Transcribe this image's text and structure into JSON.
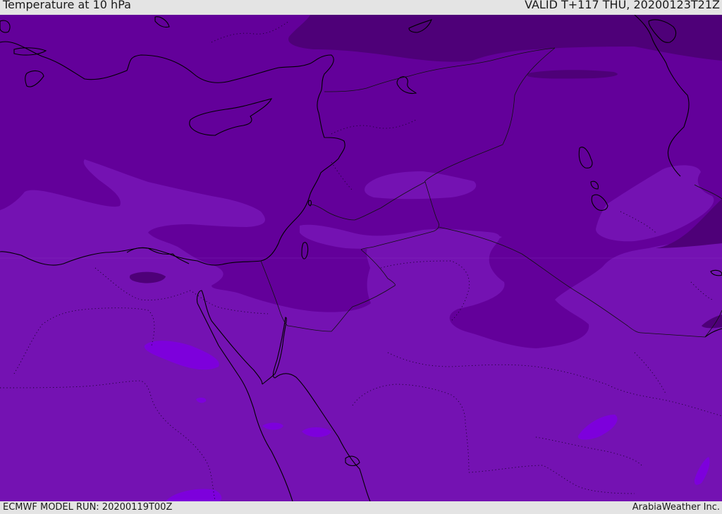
{
  "header": {
    "title": "Temperature at 10 hPa",
    "valid_time": "VALID T+117 THU, 20200123T21Z"
  },
  "footer": {
    "model_run": "ECMWF MODEL RUN: 20200119T00Z",
    "credit": "ArabiaWeather Inc."
  },
  "map": {
    "colors": {
      "cold_band": "#4e0078",
      "mid_band": "#63009a",
      "warm_band": "#7412b2",
      "warmest_band": "#7d00dc",
      "coastline": "#000000",
      "border": "#111111"
    }
  }
}
